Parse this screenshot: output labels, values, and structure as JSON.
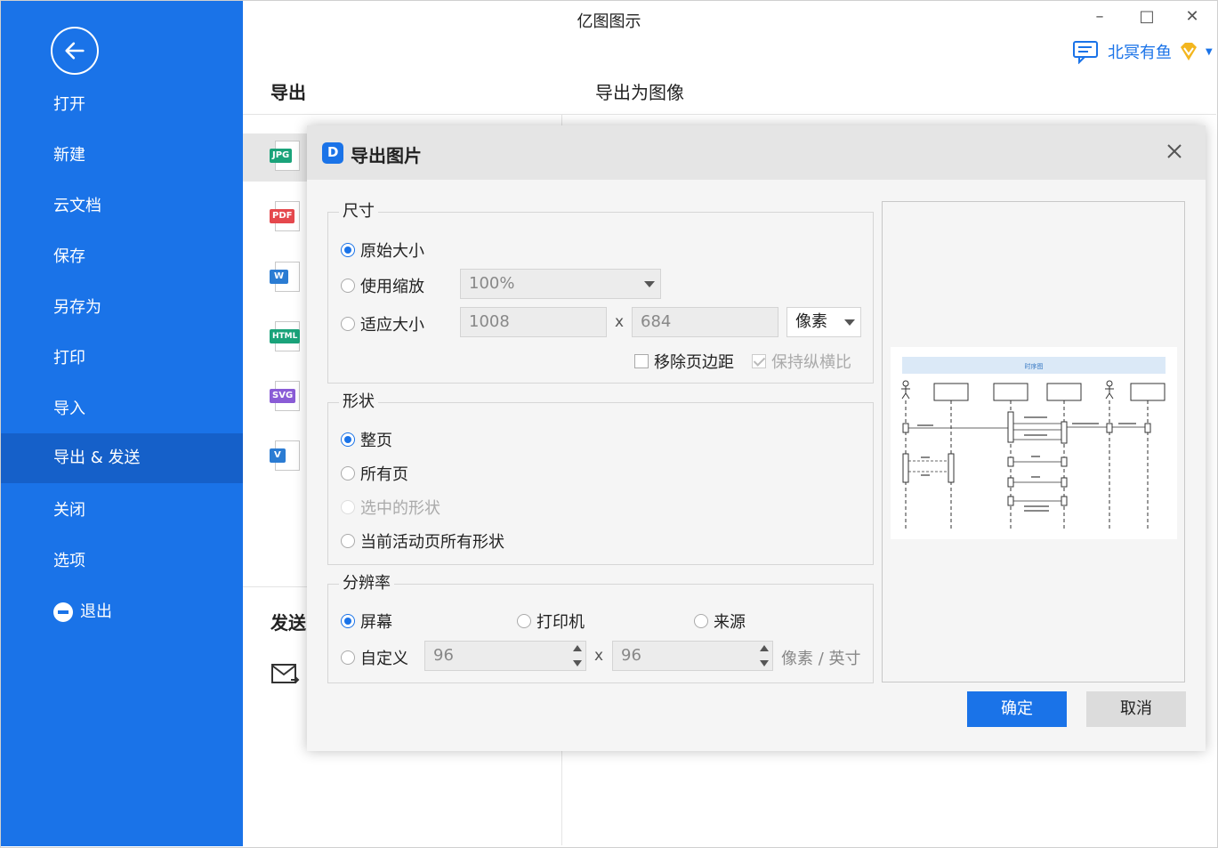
{
  "window": {
    "title": "亿图图示",
    "minimize": "–",
    "maximize": "□",
    "close": "✕",
    "user_name": "北冥有鱼"
  },
  "sidebar": {
    "items": [
      {
        "label": "打开"
      },
      {
        "label": "新建"
      },
      {
        "label": "云文档"
      },
      {
        "label": "保存"
      },
      {
        "label": "另存为"
      },
      {
        "label": "打印"
      },
      {
        "label": "导入"
      },
      {
        "label": "导出 & 发送"
      },
      {
        "label": "关闭"
      },
      {
        "label": "选项"
      },
      {
        "label": "退出"
      }
    ],
    "active_index": 7
  },
  "content": {
    "export_heading": "导出",
    "export_image_heading": "导出为图像",
    "send_heading": "发送",
    "formats": [
      {
        "tag": "JPG",
        "color": "#1aa37a"
      },
      {
        "tag": "PDF",
        "color": "#e5484d"
      },
      {
        "tag": "W",
        "color": "#2b7cd3"
      },
      {
        "tag": "HTML",
        "color": "#1aa37a"
      },
      {
        "tag": "SVG",
        "color": "#8a5cd6"
      },
      {
        "tag": "V",
        "color": "#2b7cd3"
      }
    ]
  },
  "dialog": {
    "title": "导出图片",
    "size": {
      "title": "尺寸",
      "original": "原始大小",
      "use_scale": "使用缩放",
      "scale_value": "100%",
      "fit_size": "适应大小",
      "width": "1008",
      "x_sep": "x",
      "height": "684",
      "unit": "像素",
      "remove_margin": "移除页边距",
      "keep_ratio": "保持纵横比"
    },
    "shape": {
      "title": "形状",
      "whole_page": "整页",
      "all_pages": "所有页",
      "selected_shapes": "选中的形状",
      "current_page_all": "当前活动页所有形状"
    },
    "resolution": {
      "title": "分辨率",
      "screen": "屏幕",
      "printer": "打印机",
      "source": "来源",
      "custom": "自定义",
      "dpi_x": "96",
      "x_sep": "x",
      "dpi_y": "96",
      "unit": "像素 / 英寸"
    },
    "preview": {
      "diagram_title": "时序图"
    },
    "ok": "确定",
    "cancel": "取消"
  }
}
